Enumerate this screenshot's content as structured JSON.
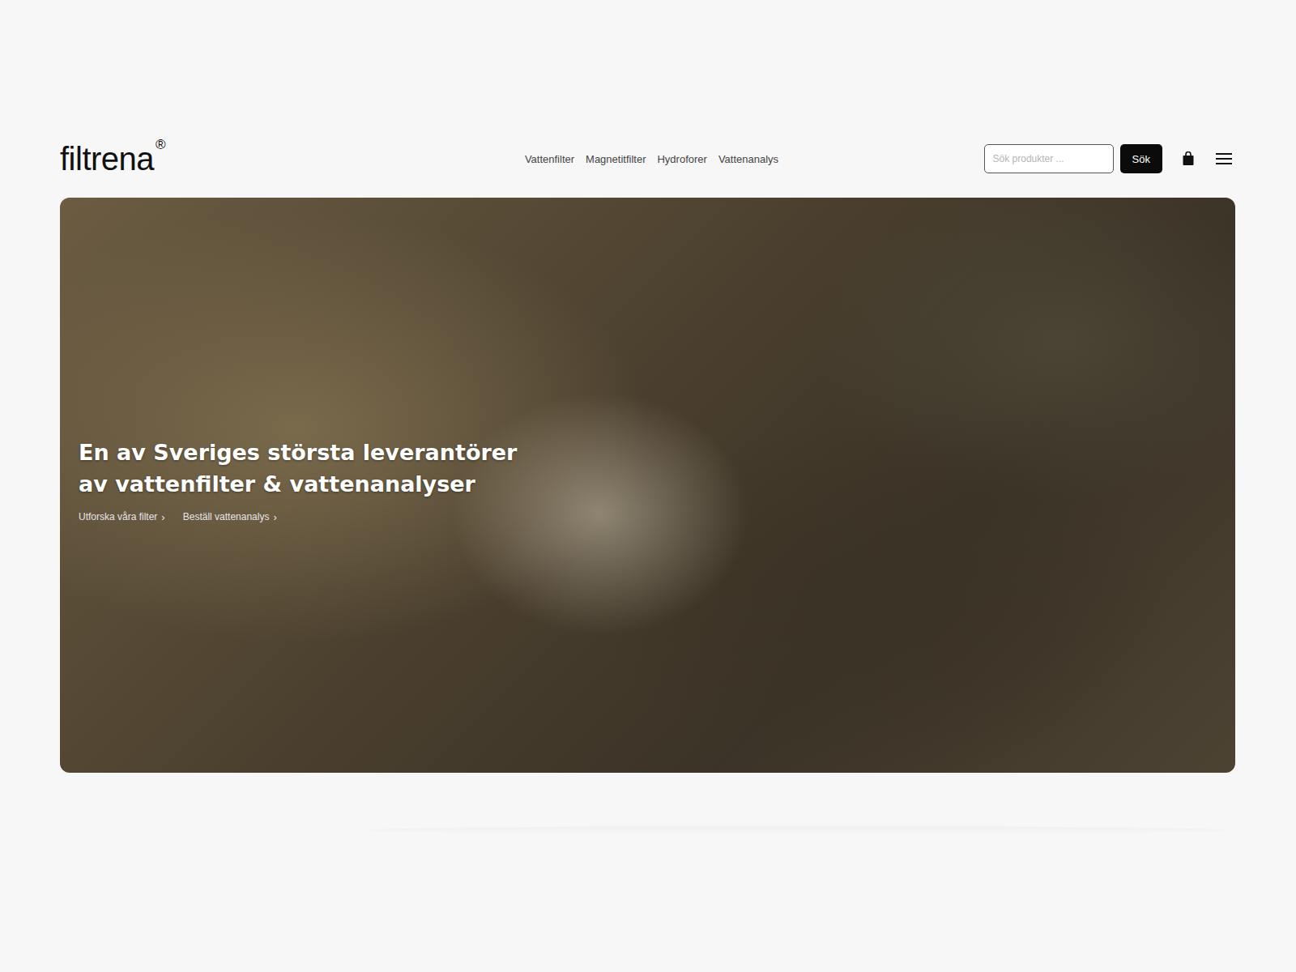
{
  "header": {
    "logo": "filtrena",
    "logo_mark": "®",
    "nav": [
      {
        "label": "Vattenfilter"
      },
      {
        "label": "Magnetitfilter"
      },
      {
        "label": "Hydroforer"
      },
      {
        "label": "Vattenanalys"
      }
    ],
    "search": {
      "placeholder": "Sök produkter ...",
      "button": "Sök"
    }
  },
  "hero": {
    "title_lines": [
      "En av Sveriges största leverantörer",
      "av vattenfilter & vattenanalyser"
    ],
    "links": [
      {
        "label": "Utforska våra filter",
        "chevron": "›"
      },
      {
        "label": "Beställ vattenanalys",
        "chevron": "›"
      }
    ]
  }
}
